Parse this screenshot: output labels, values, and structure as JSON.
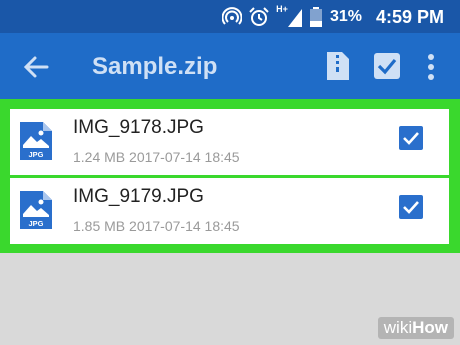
{
  "status_bar": {
    "battery_percent": "31%",
    "time": "4:59 PM",
    "network_label": "H+"
  },
  "app_bar": {
    "title": "Sample.zip",
    "icons": [
      "back-arrow-icon",
      "archive-file-icon",
      "select-all-check-icon",
      "more-vert-icon"
    ]
  },
  "files": [
    {
      "name": "IMG_9178.JPG",
      "size": "1.24 MB",
      "date": "2017-07-14 18:45",
      "icon_label": "JPG",
      "checked": true
    },
    {
      "name": "IMG_9179.JPG",
      "size": "1.85 MB",
      "date": "2017-07-14 18:45",
      "icon_label": "JPG",
      "checked": true
    }
  ],
  "watermark": {
    "wiki": "wiki",
    "how": "How"
  },
  "colors": {
    "status_bar": "#1a57a8",
    "app_bar": "#1f6cc8",
    "highlight": "#3ad82d",
    "checkbox": "#2a6fcc",
    "background": "#d9d9d9"
  }
}
